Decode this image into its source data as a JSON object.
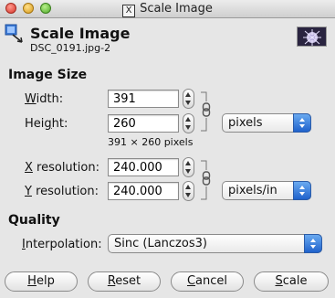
{
  "window": {
    "title": "Scale Image"
  },
  "header": {
    "title": "Scale Image",
    "subtitle": "DSC_0191.jpg-2"
  },
  "image_size": {
    "heading": "Image Size",
    "width_label_accel": "W",
    "width_label_rest": "idth:",
    "width_value": "391",
    "height_label_pre": "Hei",
    "height_label_accel": "g",
    "height_label_rest": "ht:",
    "height_value": "260",
    "unit": "pixels",
    "dimensions_text": "391 × 260 pixels",
    "xres_label_accel": "X",
    "xres_label_rest": " resolution:",
    "xres_value": "240.000",
    "yres_label_accel": "Y",
    "yres_label_rest": " resolution:",
    "yres_value": "240.000",
    "res_unit": "pixels/in"
  },
  "quality": {
    "heading": "Quality",
    "interp_label_accel": "I",
    "interp_label_rest": "nterpolation:",
    "interp_value": "Sinc (Lanczos3)"
  },
  "buttons": {
    "help_accel": "H",
    "help_rest": "elp",
    "reset_accel": "R",
    "reset_rest": "eset",
    "cancel_accel": "C",
    "cancel_rest": "ancel",
    "scale_accel": "S",
    "scale_rest": "cale"
  },
  "colors": {
    "accent": "#1f62cc",
    "window_bg": "#e6e6e6"
  }
}
